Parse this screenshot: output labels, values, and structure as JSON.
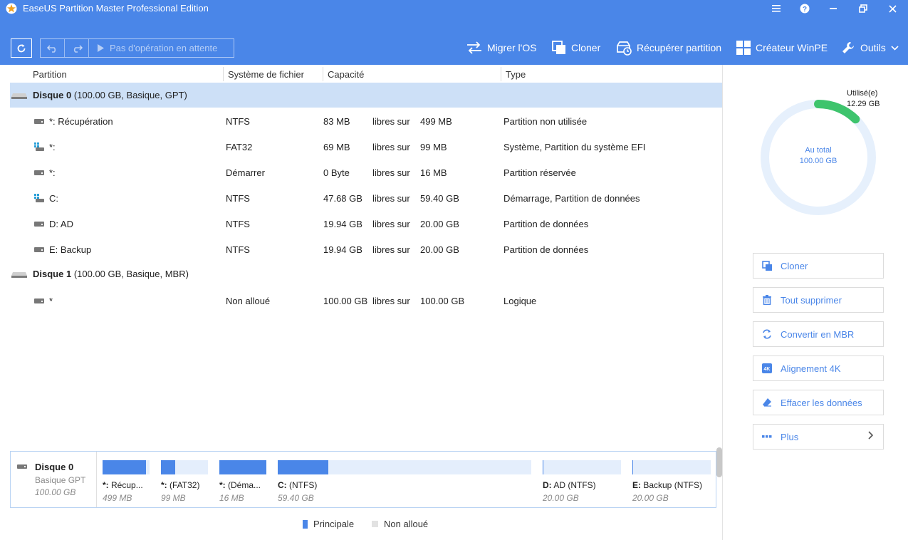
{
  "window": {
    "title": "EaseUS Partition Master Professional Edition"
  },
  "toolbar": {
    "pending": "Pas d'opération en attente",
    "migrate": "Migrer l'OS",
    "clone": "Cloner",
    "recover": "Récupérer partition",
    "winpe": "Créateur WinPE",
    "tools": "Outils"
  },
  "columns": {
    "partition": "Partition",
    "fs": "Système de fichier",
    "capacity": "Capacité",
    "type": "Type"
  },
  "disk0": {
    "name": "Disque 0",
    "info": "(100.00 GB, Basique, GPT)"
  },
  "disk1": {
    "name": "Disque 1",
    "info": "(100.00 GB, Basique, MBR)"
  },
  "rows": [
    {
      "name": "*: Récupération",
      "fs": "NTFS",
      "free": "83 MB",
      "mid": "libres sur",
      "total": "499 MB",
      "type": "Partition non utilisée"
    },
    {
      "name": "*:",
      "fs": "FAT32",
      "free": "69 MB",
      "mid": "libres sur",
      "total": "99 MB",
      "type": "Système, Partition du système EFI"
    },
    {
      "name": "*:",
      "fs": "Démarrer",
      "free": "0 Byte",
      "mid": "libres sur",
      "total": "16 MB",
      "type": "Partition réservée"
    },
    {
      "name": "C:",
      "fs": "NTFS",
      "free": "47.68 GB",
      "mid": "libres sur",
      "total": "59.40 GB",
      "type": "Démarrage, Partition de données"
    },
    {
      "name": "D: AD",
      "fs": "NTFS",
      "free": "19.94 GB",
      "mid": "libres sur",
      "total": "20.00 GB",
      "type": "Partition de données"
    },
    {
      "name": "E: Backup",
      "fs": "NTFS",
      "free": "19.94 GB",
      "mid": "libres sur",
      "total": "20.00 GB",
      "type": "Partition de données"
    },
    {
      "name": "*",
      "fs": "Non alloué",
      "free": "100.00 GB",
      "mid": "libres sur",
      "total": "100.00 GB",
      "type": "Logique"
    }
  ],
  "usage": {
    "used_label": "Utilisé(e)",
    "used_value": "12.29 GB",
    "total_label": "Au total",
    "total_value": "100.00 GB",
    "used_fraction": 0.1229
  },
  "actions": {
    "clone": "Cloner",
    "delete_all": "Tout supprimer",
    "convert": "Convertir en MBR",
    "align": "Alignement 4K",
    "wipe": "Effacer les données",
    "more": "Plus"
  },
  "diskmap": {
    "name": "Disque 0",
    "type": "Basique GPT",
    "size": "100.00 GB",
    "segments": [
      {
        "label_bold": "*:",
        "label": " Récup...",
        "size": "499 MB",
        "used_fraction": 0.92
      },
      {
        "label_bold": "*:",
        "label": " (FAT32)",
        "size": "99 MB",
        "used_fraction": 0.3
      },
      {
        "label_bold": "*:",
        "label": " (Déma...",
        "size": "16 MB",
        "used_fraction": 1.0
      },
      {
        "label_bold": "C:",
        "label": " (NTFS)",
        "size": "59.40 GB",
        "used_fraction": 0.2
      },
      {
        "label_bold": "D:",
        "label": " AD (NTFS)",
        "size": "20.00 GB",
        "used_fraction": 0.003
      },
      {
        "label_bold": "E:",
        "label": " Backup (NTFS)",
        "size": "20.00 GB",
        "used_fraction": 0.003
      }
    ]
  },
  "legend": {
    "primary": "Principale",
    "unallocated": "Non alloué"
  },
  "colors": {
    "accent": "#4a86e8",
    "used": "#3ec46d",
    "ring": "#e6f0fc",
    "selected": "#cde0f7"
  }
}
